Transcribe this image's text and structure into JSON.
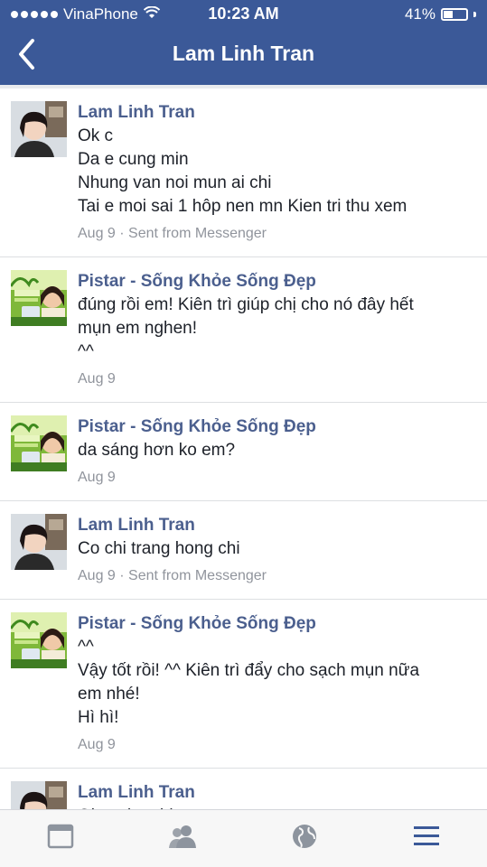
{
  "status_bar": {
    "carrier": "VinaPhone",
    "time": "10:23 AM",
    "battery_percent": "41%",
    "battery_level": 0.41
  },
  "nav": {
    "title": "Lam Linh Tran",
    "back_icon": "chevron-left-icon"
  },
  "comments": [
    {
      "author": "Lam Linh Tran",
      "avatar": "user-photo-girl",
      "lines": [
        "Ok c",
        "Da e cung min",
        "Nhung van noi mun ai chi",
        "Tai e moi sai 1 hôp nen mn Kien tri thu xem"
      ],
      "meta": "Aug 9 · Sent from Messenger"
    },
    {
      "author": "Pistar - Sống Khỏe Sống Đẹp",
      "avatar": "page-logo-pistar",
      "lines": [
        "đúng rồi em! Kiên trì giúp chị cho nó đây hết",
        "mụn em nghen!",
        "^^"
      ],
      "meta": "Aug 9"
    },
    {
      "author": "Pistar - Sống Khỏe Sống Đẹp",
      "avatar": "page-logo-pistar",
      "lines": [
        "da sáng hơn ko em?"
      ],
      "meta": "Aug 9"
    },
    {
      "author": "Lam Linh Tran",
      "avatar": "user-photo-girl",
      "lines": [
        "Co chi trang hong chi"
      ],
      "meta": "Aug 9 · Sent from Messenger"
    },
    {
      "author": "Pistar - Sống Khỏe Sống Đẹp",
      "avatar": "page-logo-pistar",
      "lines": [
        "^^",
        "Vậy tốt rồi! ^^ Kiên trì đẩy cho sạch mụn nữa",
        "em nhé!",
        "Hì hì!"
      ],
      "meta": "Aug 9"
    },
    {
      "author": "Lam Linh Tran",
      "avatar": "user-photo-girl",
      "lines": [
        "Ok z nhe chi"
      ],
      "meta": ""
    }
  ],
  "tabbar": {
    "tabs": [
      "news-feed-icon",
      "friends-icon",
      "globe-icon",
      "menu-icon"
    ],
    "active_color": "#3b5998",
    "inactive_color": "#8d949e"
  },
  "colors": {
    "header": "#3b5998",
    "author": "#4b5f8e",
    "meta": "#90949c"
  }
}
